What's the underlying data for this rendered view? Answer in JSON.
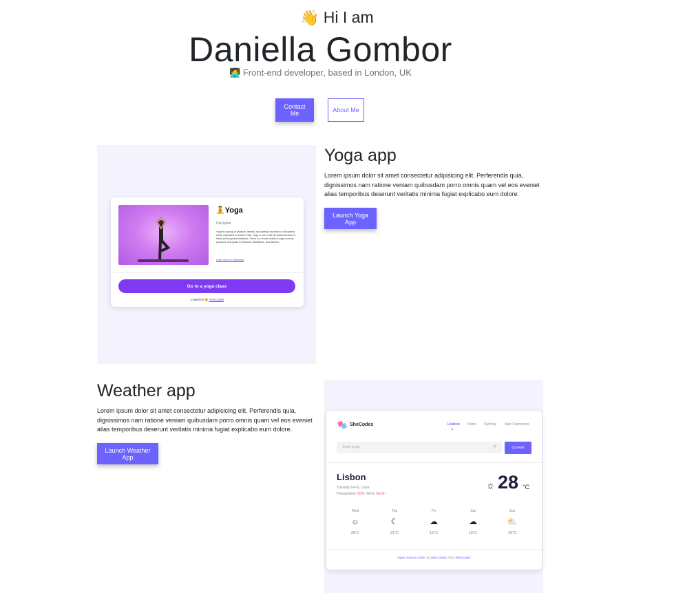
{
  "hero": {
    "greeting": "Hi I am",
    "name": "Daniella Gombor",
    "tagline": "Front-end developer, based in London, UK",
    "contact_label": "Contact Me",
    "about_label": "About Me"
  },
  "projects": [
    {
      "title": "Yoga app",
      "description": "Lorem ipsum dolor sit amet consectetur adipisicing elit. Perferendis quia, dignissimos nam ratione veniam quibusdam porro omnis quam vel eos eveniet alias temporibus deserunt veritatis minima fugiat explicabo eum dolore.",
      "button": "Launch Yoga App"
    },
    {
      "title": "Weather app",
      "description": "Lorem ipsum dolor sit amet consectetur adipisicing elit. Perferendis quia, dignissimos nam ratione veniam quibusdam porro omnis quam vel eos eveniet alias temporibus deserunt veritatis minima fugiat explicabo eum dolore.",
      "button": "Launch Weather App"
    }
  ],
  "yoga_preview": {
    "title": "Yoga",
    "subtitle": "Discipline",
    "text": "Yoga is a group of physical, mental, and spiritual practices or disciplines which originated in ancient India. Yoga is one of the six Āstika schools of Hindu philosophical traditions. There is a broad variety of yoga schools, practices, and goals in Hinduism, Buddhism, and Jainism.",
    "link": "Learn more on Wikipedia",
    "button": "Go to a yoga class",
    "coded_by": "Coded by",
    "coded_link": "SheCodes"
  },
  "weather_preview": {
    "brand": "SheCodes",
    "tabs": [
      "Lisbon",
      "Paris",
      "Sydney",
      "San Francisco"
    ],
    "search_placeholder": "Enter a city",
    "current_button": "Current",
    "city": "Lisbon",
    "date": "Tuesday 14:42, Clear",
    "precip_label": "Precipitation:",
    "precip_value": "65%",
    "wind_label": ", Wind:",
    "wind_value": "5km/h",
    "temperature": "28",
    "unit": "°C",
    "forecast": [
      {
        "day": "Wed",
        "icon": "sun-icon",
        "temp": "28°C"
      },
      {
        "day": "Thu",
        "icon": "moon-icon",
        "temp": "21°C"
      },
      {
        "day": "Fri",
        "icon": "cloud-icon",
        "temp": "16°C"
      },
      {
        "day": "Sat",
        "icon": "cloudy-moon-icon",
        "temp": "16°C"
      },
      {
        "day": "Sun",
        "icon": "partly-sunny-icon",
        "temp": "16°C"
      }
    ],
    "footer_link1": "Open-source code",
    "footer_by": ", by",
    "footer_author": "Matt Delac",
    "footer_from": "from",
    "footer_link2": "SheCodes"
  },
  "colors": {
    "accent": "#6c63ff",
    "panel": "#f4f2fd",
    "yoga_button": "#7e3af2",
    "weather_temp": "#e05a7a"
  }
}
